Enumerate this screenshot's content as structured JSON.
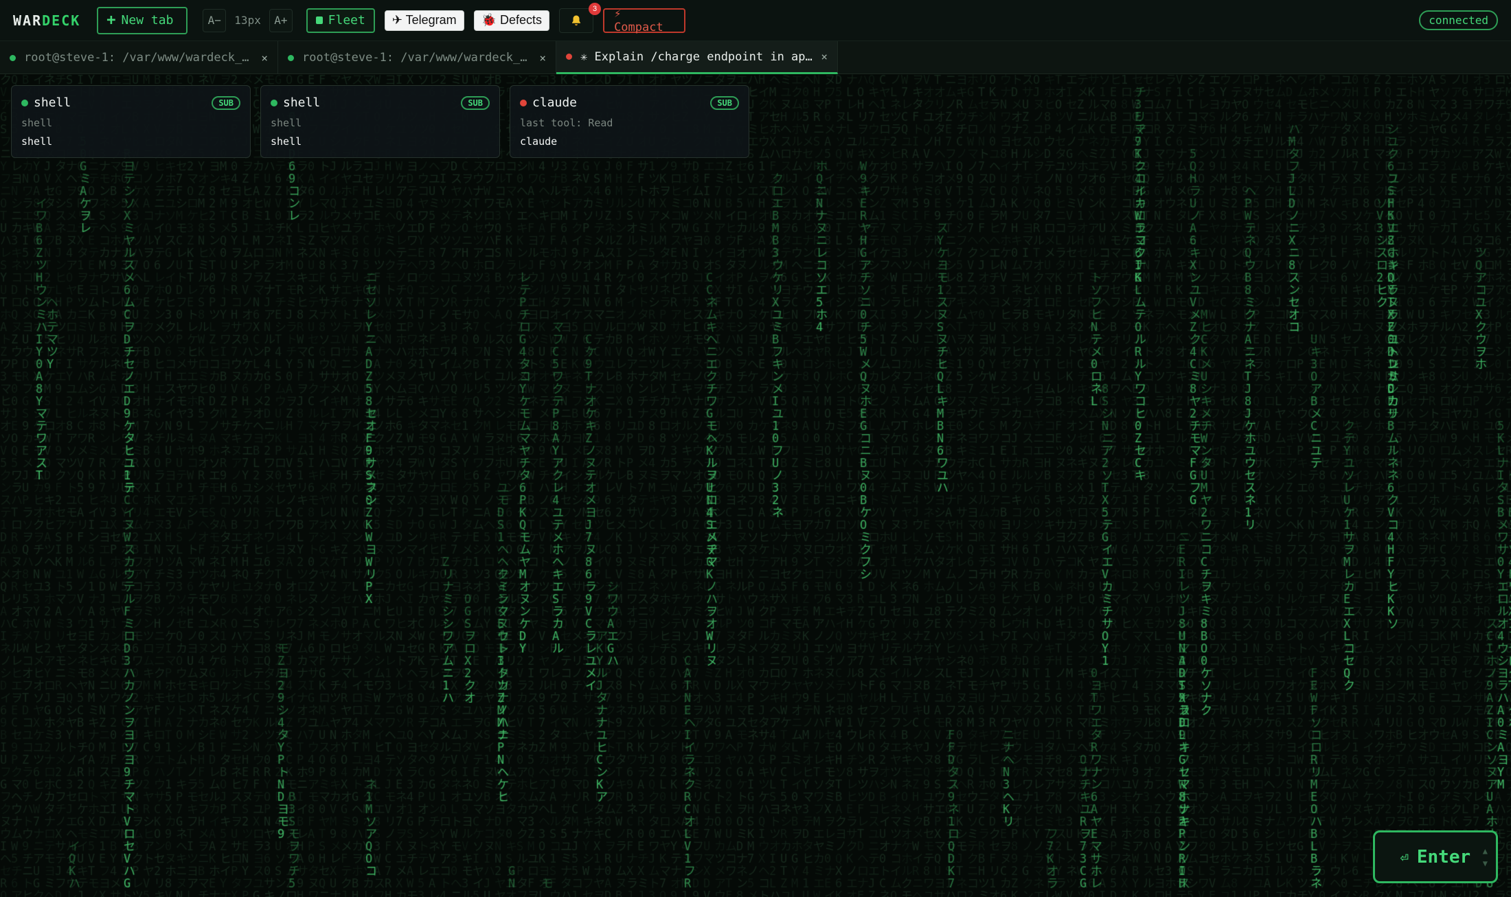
{
  "app": {
    "logo_a": "WAR",
    "logo_b": "DECK",
    "connection_status": "connected"
  },
  "toolbar": {
    "new_tab": "New tab",
    "font_decrease": "A−",
    "font_size": "13px",
    "font_increase": "A+",
    "fleet": "Fleet",
    "telegram": "✈ Telegram",
    "defects": "🐞 Defects",
    "notifications_count": "3",
    "compact": "⚡ Compact"
  },
  "tabs": [
    {
      "label": "root@steve-1: /var/www/wardeck_b…",
      "close": "×",
      "status_color": "#2eb860"
    },
    {
      "label": "root@steve-1: /var/www/wardeck_b…",
      "close": "×",
      "status_color": "#2eb860"
    },
    {
      "label": "✳ Explain /charge endpoint in ap…",
      "close": "×",
      "status_color": "#e0453a"
    }
  ],
  "sessions": [
    {
      "title": "shell",
      "badge": "SUB",
      "meta": "shell",
      "command": "shell",
      "status_color": "#2eb860"
    },
    {
      "title": "shell",
      "badge": "SUB",
      "meta": "shell",
      "command": "shell",
      "status_color": "#2eb860"
    },
    {
      "title": "claude",
      "badge": "SUB",
      "meta": "last tool: Read",
      "command": "claude",
      "status_color": "#e0453a"
    }
  ],
  "enter_button": {
    "label": "Enter",
    "icon": "⏎"
  },
  "colors": {
    "accent": "#2eb860",
    "danger": "#e0453a",
    "background": "#050a07"
  },
  "icons": {
    "bell": "bell-icon",
    "plus": "plus-icon",
    "fleet": "fleet-square-icon"
  }
}
